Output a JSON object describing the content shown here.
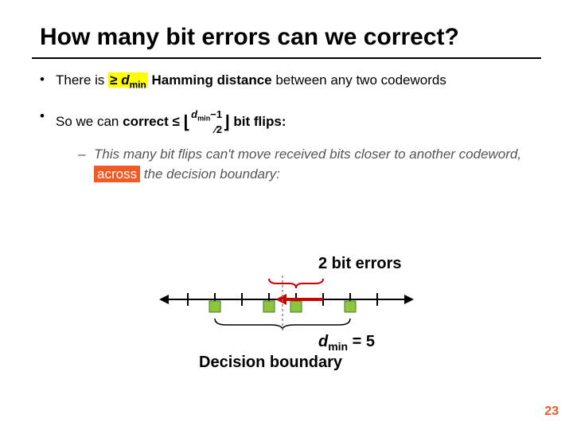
{
  "title": "How many bit errors can we correct?",
  "bullets": {
    "b1_prefix": "There is ",
    "b1_hl": "≥ ",
    "b1_dmin_d": "d",
    "b1_dmin_sub": "min",
    "b1_mid": " Hamming distance",
    "b1_rest": " between any two codewords",
    "b2_prefix": "So we can ",
    "b2_correct": "correct ≤ ",
    "b2_floor_l": "⌊",
    "b2_frac_num_d": "d",
    "b2_frac_num_sub": "min",
    "b2_frac_num_tail": "−1",
    "b2_frac_den": "2",
    "b2_floor_r": "⌋",
    "b2_tail": " bit flips:",
    "sub_prefix": "This many bit flips can't move received bits closer to another codeword, ",
    "sub_hl": "across",
    "sub_tail": " the decision boundary:"
  },
  "diagram": {
    "label_2bit": "2 bit errors",
    "dmin_d": "d",
    "dmin_sub": "min",
    "dmin_eq": " = 5",
    "decision": "Decision boundary"
  },
  "pagenum": "23"
}
